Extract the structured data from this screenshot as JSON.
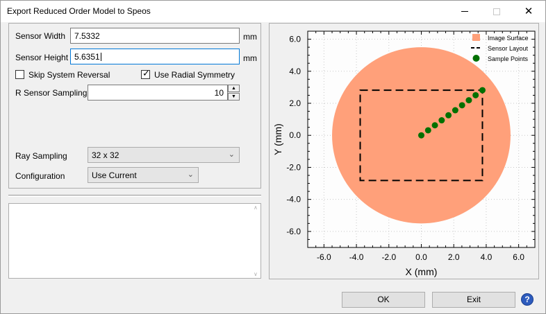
{
  "window": {
    "title": "Export Reduced Order Model to Speos"
  },
  "form": {
    "sensor_width": {
      "label": "Sensor Width",
      "value": "7.5332",
      "unit": "mm"
    },
    "sensor_height": {
      "label": "Sensor Height",
      "value": "5.6351",
      "unit": "mm"
    },
    "skip_system_reversal": {
      "label": "Skip System Reversal",
      "checked": false
    },
    "use_radial_symmetry": {
      "label": "Use Radial Symmetry",
      "checked": true
    },
    "r_sensor_sampling": {
      "label": "R Sensor Sampling",
      "value": "10"
    },
    "ray_sampling": {
      "label": "Ray Sampling",
      "value": "32 x 32"
    },
    "configuration": {
      "label": "Configuration",
      "value": "Use Current"
    }
  },
  "buttons": {
    "ok": "OK",
    "exit": "Exit",
    "help": "?"
  },
  "chart_data": {
    "type": "scatter",
    "xlabel": "X (mm)",
    "ylabel": "Y (mm)",
    "xlim": [
      -7,
      7
    ],
    "ylim": [
      -7,
      6.5
    ],
    "xticks": [
      -6,
      -4,
      -2,
      0,
      2,
      4,
      6
    ],
    "yticks": [
      -6,
      -4,
      -2,
      0,
      2,
      4,
      6
    ],
    "xtick_labels": [
      "-6.0",
      "-4.0",
      "-2.0",
      "0.0",
      "2.0",
      "4.0",
      "6.0"
    ],
    "ytick_labels": [
      "-6.0",
      "-4.0",
      "-2.0",
      "0.0",
      "2.0",
      "4.0",
      "6.0"
    ],
    "grid": true,
    "legend_position": "top-right",
    "legend": [
      "Image Surface",
      "Sensor Layout",
      "Sample Points"
    ],
    "image_surface": {
      "center": [
        0,
        0
      ],
      "radius": 5.5,
      "color": "#ffa07a"
    },
    "sensor_layout": {
      "x": [
        -3.7666,
        3.7666
      ],
      "y": [
        -2.8176,
        2.8176
      ],
      "color": "#000000"
    },
    "sample_points": {
      "color": "#007000",
      "x": [
        0.0,
        0.419,
        0.837,
        1.256,
        1.674,
        2.093,
        2.511,
        2.93,
        3.348,
        3.767
      ],
      "y": [
        0.0,
        0.313,
        0.626,
        0.939,
        1.252,
        1.565,
        1.878,
        2.191,
        2.504,
        2.818
      ]
    }
  }
}
